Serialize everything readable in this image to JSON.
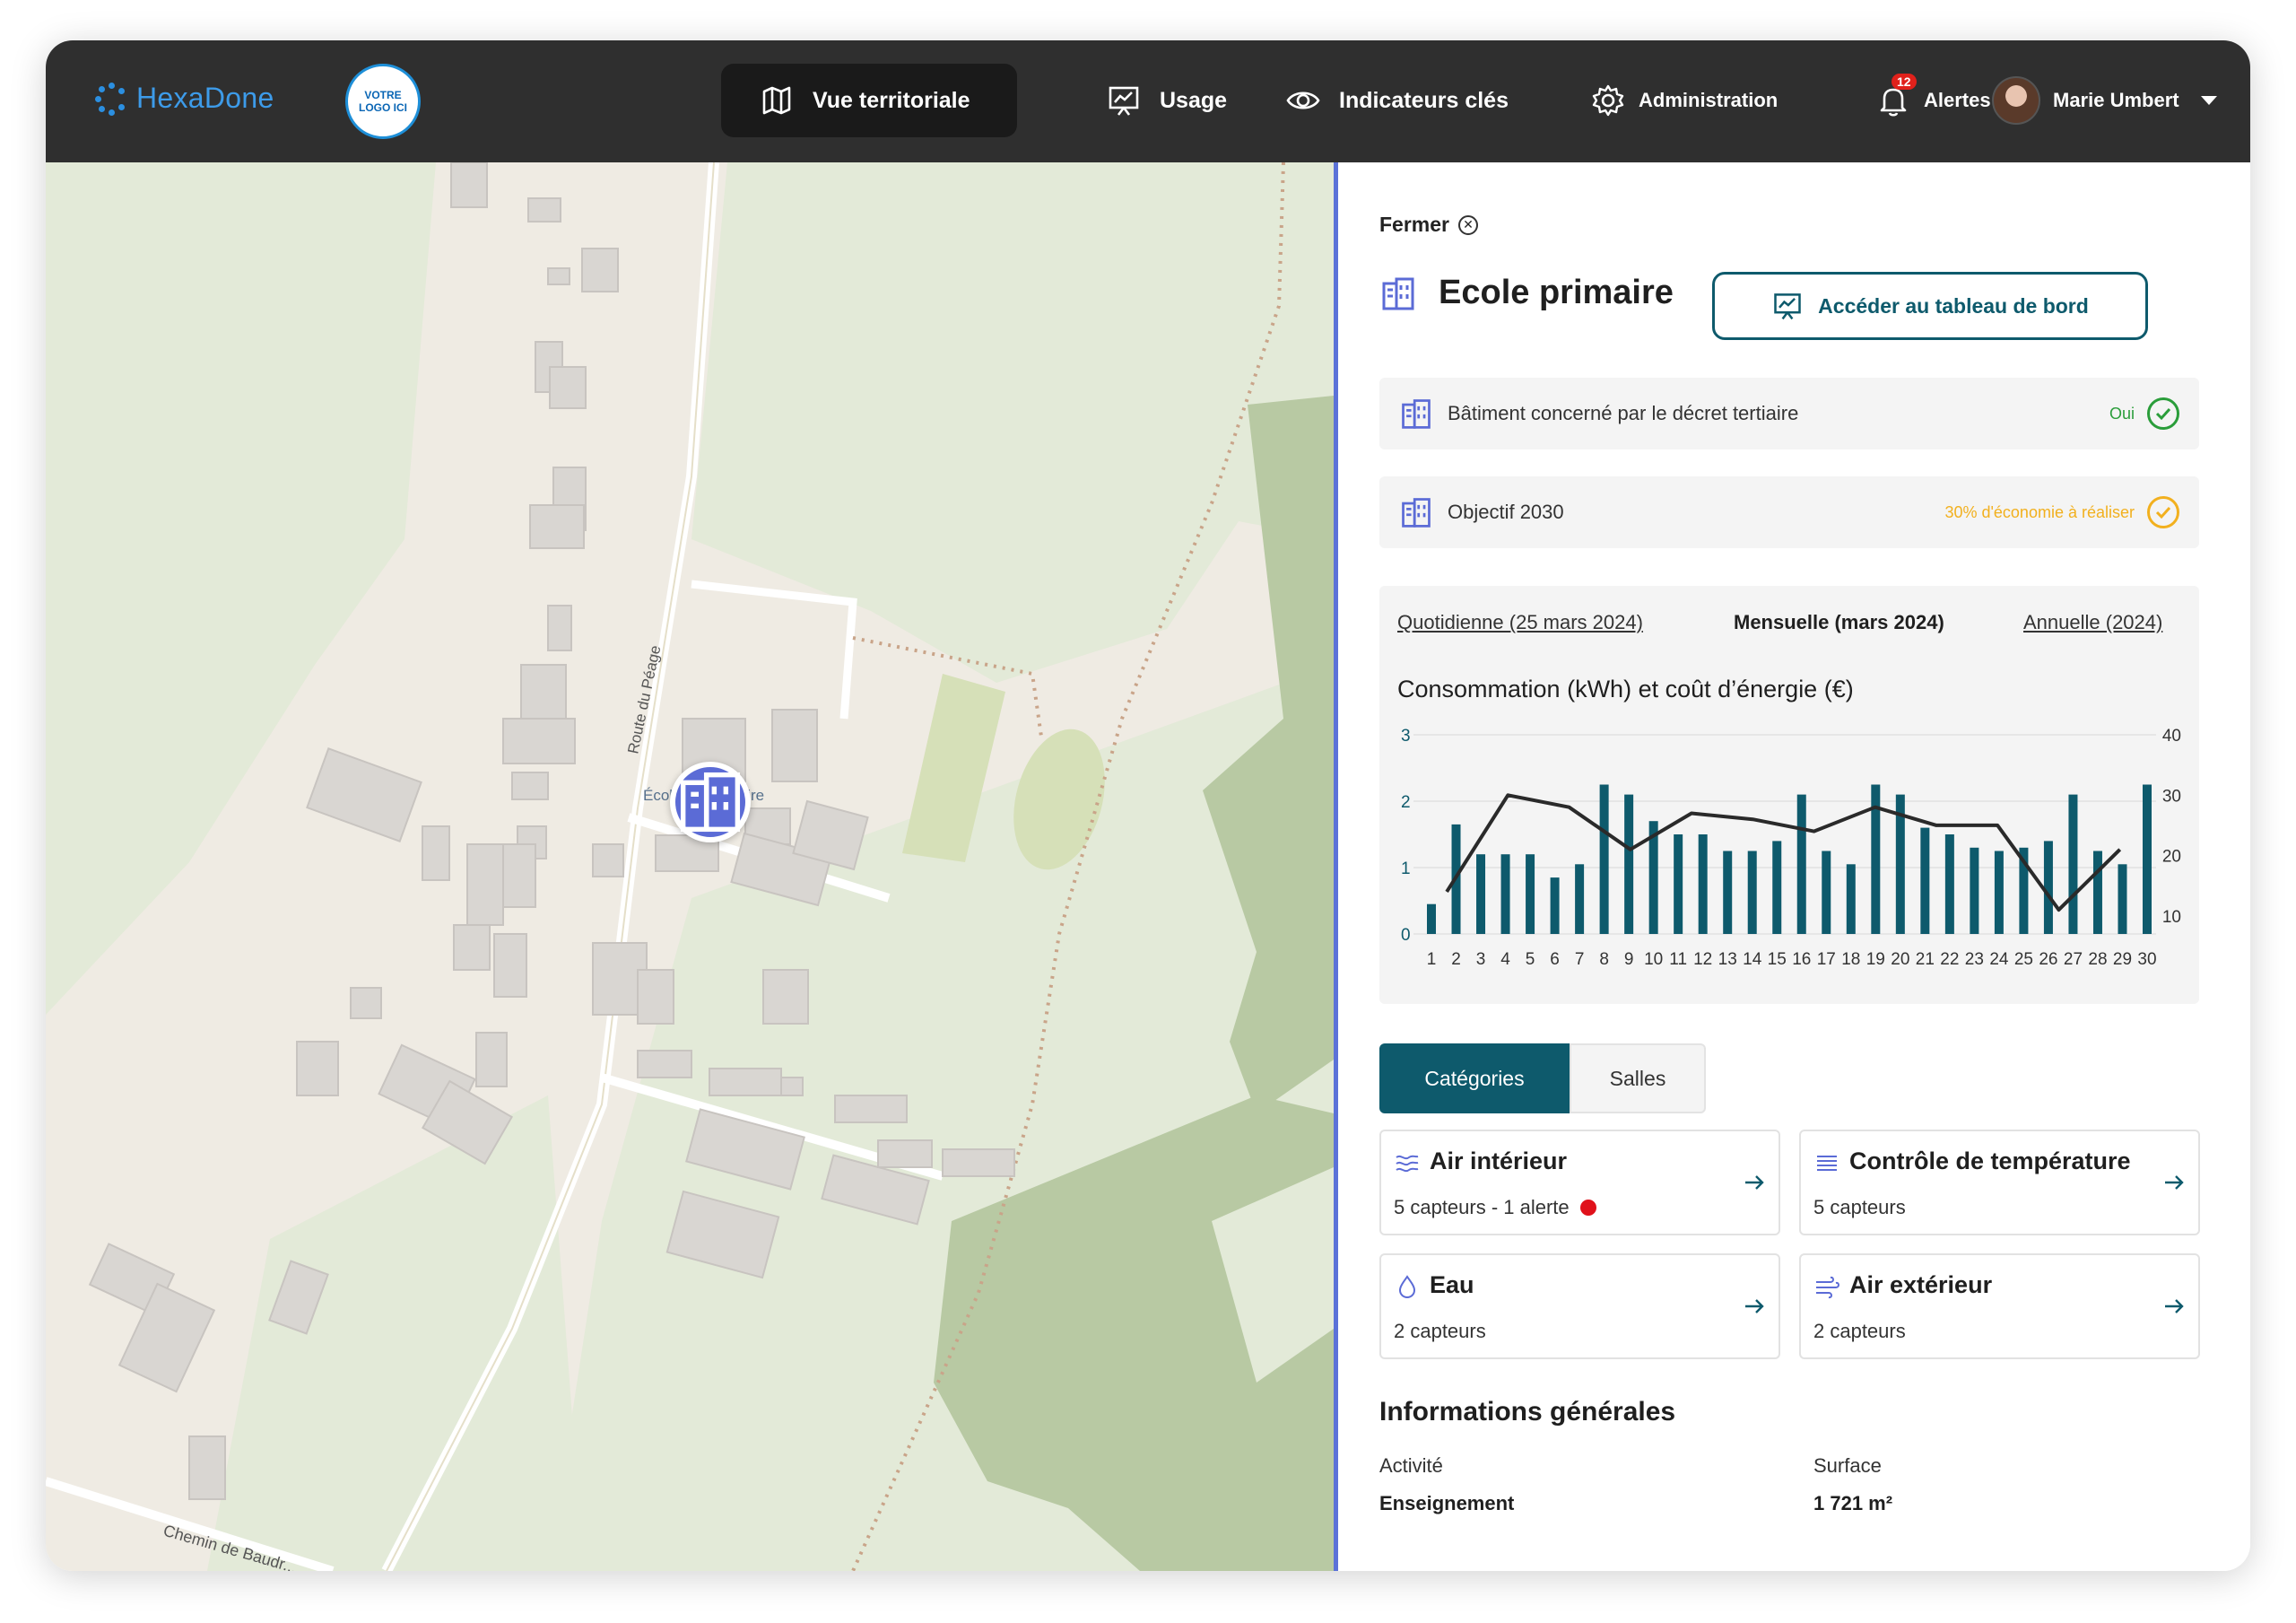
{
  "brand": {
    "name": "HexaDone",
    "logo_line1": "VOTRE",
    "logo_line2": "LOGO ICI"
  },
  "nav": {
    "vue_territoriale": "Vue territoriale",
    "usage": "Usage",
    "indicateurs": "Indicateurs clés",
    "administration": "Administration",
    "alertes": "Alertes",
    "alert_count": "12",
    "user": "Marie Umbert"
  },
  "map": {
    "road_label": "Route du Péage",
    "road_label_2": "Chemin de Baudr...",
    "pin_label_left": "École",
    "pin_label_right": "taire"
  },
  "panel": {
    "close_label": "Fermer",
    "title": "Ecole primaire",
    "dashboard_button": "Accéder au tableau de bord",
    "decret": {
      "label": "Bâtiment concerné par le décret tertiaire",
      "value": "Oui"
    },
    "objectif": {
      "label": "Objectif 2030",
      "value": "30% d'économie à réaliser"
    },
    "periods": {
      "daily": "Quotidienne (25 mars 2024)",
      "monthly": "Mensuelle (mars 2024)",
      "yearly": "Annuelle (2024)"
    },
    "tabs": {
      "categories": "Catégories",
      "salles": "Salles"
    },
    "cards": [
      {
        "title": "Air intérieur",
        "sub": "5 capteurs - 1 alerte",
        "icon": "wind-icon"
      },
      {
        "title": "Contrôle de température",
        "sub": "5 capteurs",
        "icon": "lines-icon"
      },
      {
        "title": "Eau",
        "sub": "2 capteurs",
        "icon": "drop-icon"
      },
      {
        "title": "Air extérieur",
        "sub": "2 capteurs",
        "icon": "wind-out-icon"
      }
    ],
    "general": {
      "title": "Informations générales",
      "activite_label": "Activité",
      "activite_value": "Enseignement",
      "surface_label": "Surface",
      "surface_value": "1 721 m²"
    }
  },
  "colors": {
    "accent": "#0e5a6c",
    "bar": "#0e5a6c",
    "line": "#2a2a2a",
    "ok": "#2a9d3a",
    "warn": "#f2b01e",
    "alert": "#e0121b",
    "pin": "#5b6bd6"
  },
  "chart_data": {
    "type": "bar",
    "title": "Consommation (kWh) et coût d’énergie (€)",
    "categories": [
      "1",
      "2",
      "3",
      "4",
      "5",
      "6",
      "7",
      "8",
      "9",
      "10",
      "11",
      "12",
      "13",
      "14",
      "15",
      "16",
      "17",
      "18",
      "19",
      "20",
      "21",
      "22",
      "23",
      "24",
      "25",
      "26",
      "27",
      "28",
      "29",
      "30"
    ],
    "y_left": {
      "ticks": [
        "0",
        "1",
        "2",
        "3"
      ],
      "range": [
        0,
        3
      ]
    },
    "y_right": {
      "ticks": [
        "10",
        "20",
        "30",
        "40"
      ],
      "range": [
        7,
        40
      ]
    },
    "series": [
      {
        "values": [
          0.45,
          1.65,
          1.2,
          1.2,
          1.2,
          0.85,
          1.05,
          2.25,
          2.1,
          1.7,
          1.5,
          1.5,
          1.25,
          1.25,
          1.4,
          2.1,
          1.25,
          1.05,
          2.25,
          2.1,
          1.6,
          1.5,
          1.3,
          1.25,
          1.3,
          1.4,
          2.1,
          1.25,
          1.05,
          2.25
        ]
      },
      {
        "axis": "right",
        "values": [
          14,
          null,
          30,
          null,
          28,
          null,
          21,
          null,
          27,
          null,
          26,
          null,
          24,
          null,
          28,
          null,
          25,
          null,
          25,
          null,
          11,
          null,
          21
        ]
      }
    ]
  }
}
